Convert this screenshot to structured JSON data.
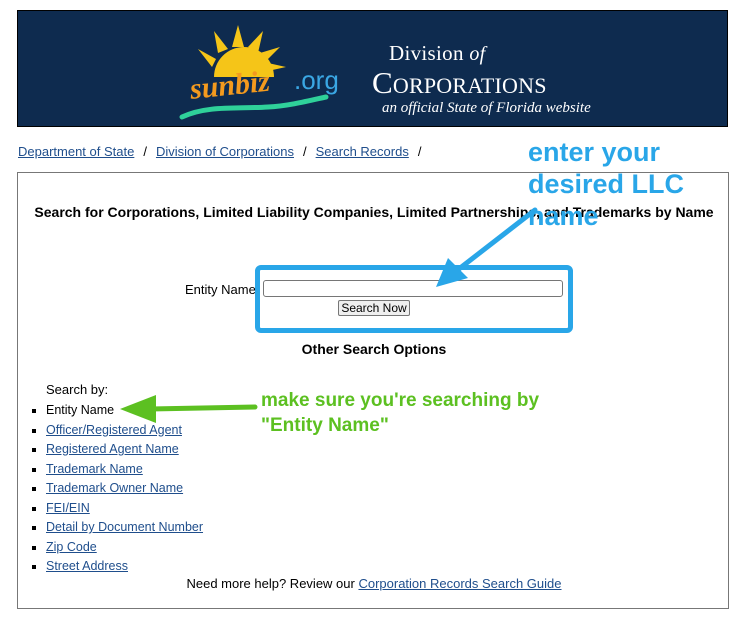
{
  "banner": {
    "logo_sun": "sunbiz",
    "logo_org": ".org",
    "division_prefix": "Division",
    "division_of": "of",
    "corporations": "Corporations",
    "tagline": "an official State of Florida website",
    "colors": {
      "background": "#0e2b4f",
      "sun": "#f5c518",
      "sunbiz_text": "#f39a1e",
      "org_text": "#3aa7e4",
      "swoosh": "#2fd19a"
    }
  },
  "breadcrumb": {
    "items": [
      "Department of State",
      "Division of Corporations",
      "Search Records"
    ],
    "separator": "/"
  },
  "search": {
    "title": "Search for Corporations, Limited Liability Companies, Limited Partnerships, and Trademarks by Name",
    "entity_label": "Entity Name",
    "entity_value": "",
    "button_label": "Search Now"
  },
  "other_options": {
    "title": "Other Search Options",
    "search_by_label": "Search by:",
    "items": [
      {
        "label": "Entity Name",
        "link": false
      },
      {
        "label": "Officer/Registered Agent",
        "link": true
      },
      {
        "label": "Registered Agent Name",
        "link": true
      },
      {
        "label": "Trademark Name",
        "link": true
      },
      {
        "label": "Trademark Owner Name",
        "link": true
      },
      {
        "label": "FEI/EIN",
        "link": true
      },
      {
        "label": "Detail by Document Number",
        "link": true
      },
      {
        "label": "Zip Code",
        "link": true
      },
      {
        "label": "Street Address",
        "link": true
      }
    ]
  },
  "help": {
    "text": "Need more help? Review our ",
    "link_label": "Corporation Records Search Guide"
  },
  "annotations": {
    "blue_note": "enter your desired LLC name",
    "green_note_line1": "make sure you're searching by",
    "green_note_line2": "\"Entity Name\"",
    "colors": {
      "blue": "#29a6e8",
      "green": "#5cc021",
      "link": "#1f4e8c"
    }
  }
}
